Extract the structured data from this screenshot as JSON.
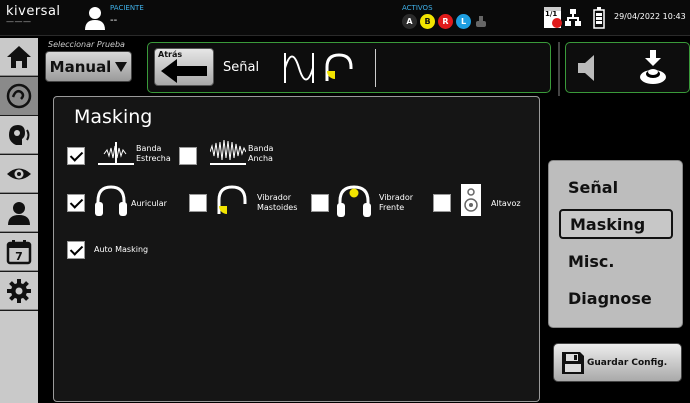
{
  "topbar": {
    "logo_line1": "kiversal",
    "logo_line2": "———",
    "patient_label": "PACIENTE",
    "patient_value": "--",
    "activos_label": "ACTIVOS",
    "badges": [
      {
        "text": "A",
        "bg": "#2b2b2b",
        "fg": "#ffffff"
      },
      {
        "text": "B",
        "bg": "#f2e400",
        "fg": "#111111"
      },
      {
        "text": "R",
        "bg": "#e01b1b",
        "fg": "#ffffff"
      },
      {
        "text": "L",
        "bg": "#1e9ee0",
        "fg": "#ffffff"
      }
    ],
    "screen_count": "1/1",
    "datetime": "29/04/2022 10:43"
  },
  "sidebar": {
    "items": [
      {
        "icon": "home-icon"
      },
      {
        "icon": "audiometry-icon",
        "active": true
      },
      {
        "icon": "speech-icon"
      },
      {
        "icon": "eye-icon"
      },
      {
        "icon": "user-icon"
      },
      {
        "icon": "calendar-icon",
        "text": "7"
      },
      {
        "icon": "gear-icon"
      }
    ]
  },
  "header": {
    "select_label": "Seleccionar Prueba",
    "manual_label": "Manual",
    "back_label": "Atrás",
    "signal_title": "Señal"
  },
  "main": {
    "title": "Masking",
    "options": {
      "banda_estrecha": {
        "label_1": "Banda",
        "label_2": "Estrecha",
        "checked": true
      },
      "banda_ancha": {
        "label_1": "Banda",
        "label_2": "Ancha",
        "checked": false
      },
      "auricular": {
        "label": "Auricular",
        "checked": true
      },
      "vibrador_mastoides": {
        "label_1": "Vibrador",
        "label_2": "Mastoides",
        "checked": false
      },
      "vibrador_frente": {
        "label_1": "Vibrador",
        "label_2": "Frente",
        "checked": false
      },
      "altavoz": {
        "label": "Altavoz",
        "checked": false
      },
      "auto_masking": {
        "label": "Auto Masking",
        "checked": true
      }
    }
  },
  "menu": {
    "items": [
      {
        "label": "Señal",
        "active": false
      },
      {
        "label": "Masking",
        "active": true
      },
      {
        "label": "Misc.",
        "active": false
      },
      {
        "label": "Diagnose",
        "active": false
      }
    ]
  },
  "save_button": {
    "label": "Guardar Config."
  },
  "colors": {
    "accent_green": "#3a9a3a",
    "info_blue": "#3fb0e8",
    "vibrator_yellow": "#f2e400"
  }
}
